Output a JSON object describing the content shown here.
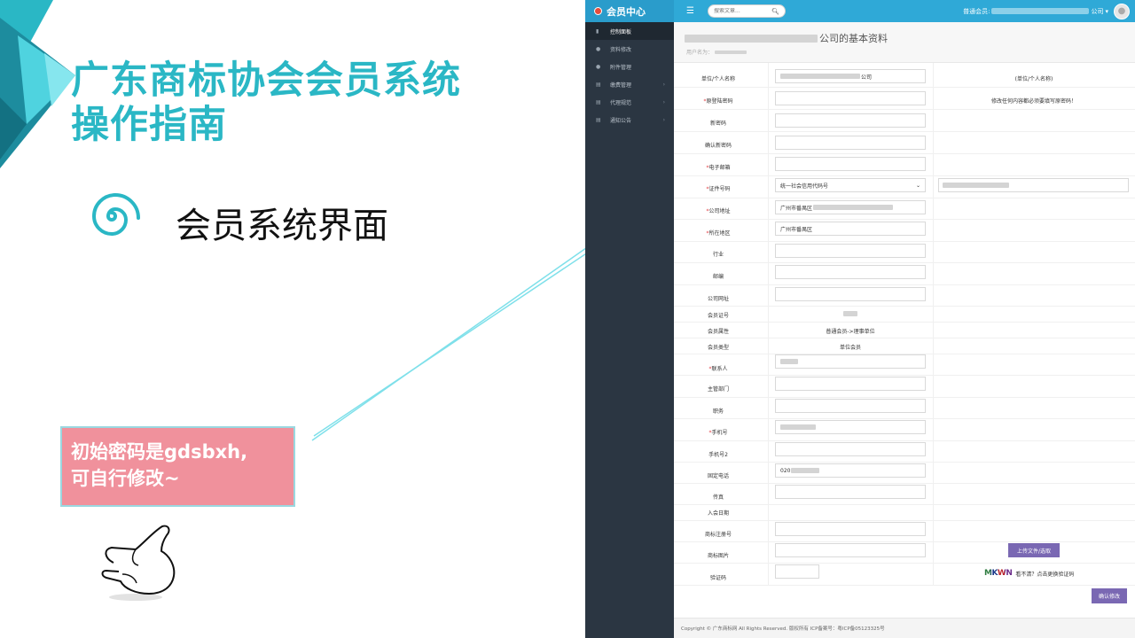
{
  "slide": {
    "title_line1": "广东商标协会会员系统",
    "title_line2": "操作指南",
    "section_heading": "会员系统界面",
    "callout_line1": "初始密码是gdsbxh,",
    "callout_line2": "可自行修改~"
  },
  "app": {
    "brand": "会员中心",
    "search_placeholder": "搜索文章...",
    "user_prefix": "普通会员:",
    "user_suffix": "公司",
    "sidebar": [
      {
        "label": "控制面板",
        "icon": "bar-chart-icon",
        "active": true,
        "chevron": false
      },
      {
        "label": "资料修改",
        "icon": "user-icon",
        "active": false,
        "chevron": false
      },
      {
        "label": "附件管理",
        "icon": "user-icon",
        "active": false,
        "chevron": false
      },
      {
        "label": "缴费管理",
        "icon": "list-icon",
        "active": false,
        "chevron": true
      },
      {
        "label": "代理规范",
        "icon": "list-icon",
        "active": false,
        "chevron": true
      },
      {
        "label": "通知公告",
        "icon": "list-icon",
        "active": false,
        "chevron": true
      }
    ],
    "page_title_suffix": "公司的基本资料",
    "page_sub_prefix": "用户名为：",
    "form": {
      "name_label": "单位/个人名称",
      "name_value_suffix": "公司",
      "name_hint": "(单位/个人名称)",
      "old_password_label": "原登陆密码",
      "old_password_hint": "修改任何内容都必须要填写原密码！",
      "new_password_label": "新密码",
      "confirm_password_label": "确认新密码",
      "email_label": "电子邮箱",
      "cert_label": "证件号码",
      "cert_select_value": "统一社会信用代码号",
      "address_label": "公司地址",
      "address_value": "广州市番禺区",
      "region_label": "所在地区",
      "region_value": "广州市番禺区",
      "industry_label": "行业",
      "postcode_label": "邮编",
      "website_label": "公司网址",
      "member_no_label": "会员证号",
      "member_attr_label": "会员属性",
      "member_attr_value": "普通会员->理事单位",
      "member_type_label": "会员类型",
      "member_type_value": "单位会员",
      "contact_label": "联系人",
      "dept_label": "主管部门",
      "position_label": "职务",
      "mobile_label": "手机号",
      "mobile2_label": "手机号2",
      "phone_label": "固定电话",
      "phone_value": "020",
      "fax_label": "传真",
      "join_date_label": "入会日期",
      "trademark_no_label": "商标注册号",
      "trademark_img_label": "商标图片",
      "upload_button": "上传文件/选取",
      "captcha_label": "验证码",
      "captcha_text": "MKWN",
      "captcha_hint": "看不清？点击更换验证码",
      "submit_button": "确认修改"
    },
    "footer": "Copyright © 广东商标网 All Rights Reserved. 版权所有 ICP备案号：粤ICP备05123325号"
  },
  "colors": {
    "title_teal": "#2ab7c5",
    "callout_pink": "#f0919c",
    "topbar_blue": "#2fa9d7",
    "sidebar_dark": "#2b3642",
    "button_purple": "#7a68b3"
  }
}
